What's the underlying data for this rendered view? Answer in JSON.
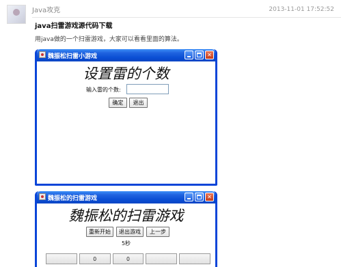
{
  "post": {
    "author": "Java攻克",
    "timestamp": "2013-11-01 17:52:52",
    "title": "java扫雷游戏源代码下载",
    "description": "用java做的一个扫雷游戏，大家可以看看里面的算法。"
  },
  "window1": {
    "title": "魏振松扫雷小游戏",
    "heading": "设置雷的个数",
    "field_label": "输入雷的个数:",
    "field_value": "",
    "ok_label": "确定",
    "exit_label": "退出"
  },
  "window2": {
    "title": "魏振松的扫雷游戏",
    "heading": "魏振松的扫雷游戏",
    "restart_label": "重新开始",
    "quit_label": "退出游戏",
    "back_label": "上一步",
    "timer": "5秒",
    "cells": [
      "",
      "0",
      "0",
      "",
      ""
    ]
  },
  "colors": {
    "titlebar_blue": "#0a4dd3",
    "close_red": "#c53c1a"
  },
  "icons": [
    "avatar",
    "java-app-icon",
    "minimize-icon",
    "maximize-icon",
    "close-icon"
  ]
}
